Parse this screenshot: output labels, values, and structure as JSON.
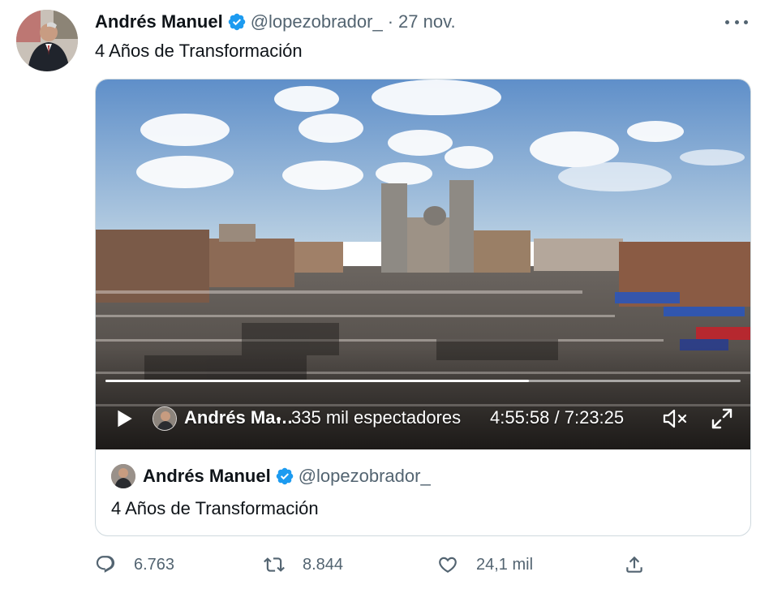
{
  "tweet": {
    "author_name": "Andrés Manuel",
    "handle": "@lopezobrador_",
    "separator": "·",
    "date": "27 nov.",
    "text": "4 Años de Transformación"
  },
  "video": {
    "author_truncated": "Andrés Ma…",
    "viewers": "335 mil espectadores",
    "time": "4:55:58 / 7:23:25",
    "progress": 0.667
  },
  "quoted": {
    "author_name": "Andrés Manuel",
    "handle": "@lopezobrador_",
    "text": "4 Años de Transformación"
  },
  "actions": {
    "replies": "6.763",
    "retweets": "8.844",
    "likes": "24,1 mil"
  },
  "icons": [
    "verified-icon",
    "more-icon",
    "play-icon",
    "mute-icon",
    "fullscreen-icon",
    "reply-icon",
    "retweet-icon",
    "like-icon",
    "share-icon"
  ],
  "colors": {
    "verified": "#1d9bf0",
    "secondary_text": "#536471",
    "border": "#cfd9de"
  }
}
